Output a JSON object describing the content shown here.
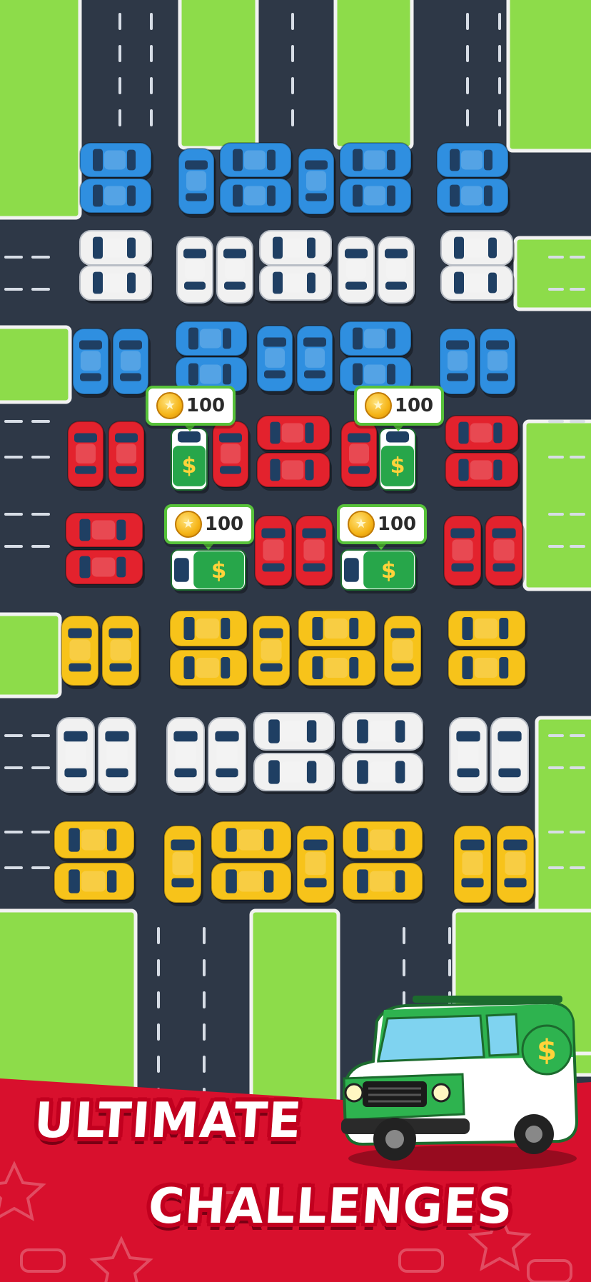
{
  "promo": {
    "line1": "ULTIMATE",
    "line2": "CHALLENGES"
  },
  "rewards": [
    {
      "id": "reward-1",
      "icon": "star-coin-icon",
      "amount": "100"
    },
    {
      "id": "reward-2",
      "icon": "star-coin-icon",
      "amount": "100"
    },
    {
      "id": "reward-3",
      "icon": "star-coin-icon",
      "amount": "100"
    },
    {
      "id": "reward-4",
      "icon": "star-coin-icon",
      "amount": "100"
    }
  ],
  "colors": {
    "road": "#2e3847",
    "grass": "#8ddc4a",
    "blue_car": "#2f8fe0",
    "white_car": "#f1f1f1",
    "red_car": "#e3222d",
    "yellow_car": "#f7c31a",
    "money_truck": "#27a64a",
    "banner_red": "#d8102d"
  },
  "hero_vehicle": {
    "name": "money-truck-icon",
    "symbol": "$"
  }
}
